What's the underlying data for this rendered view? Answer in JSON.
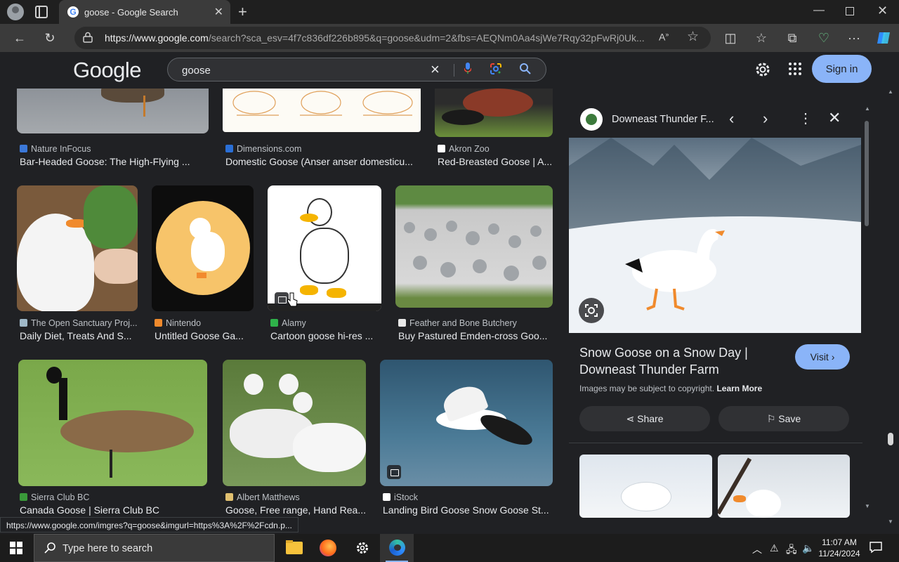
{
  "browser": {
    "tab_title": "goose - Google Search",
    "url_host": "https://www.google.com",
    "url_rest": "/search?sca_esv=4f7c836df226b895&q=goose&udm=2&fbs=AEQNm0Aa4sjWe7Rqy32pFwRj0Uk..."
  },
  "google": {
    "logo": "Google",
    "query": "goose",
    "signin_label": "Sign in"
  },
  "results": [
    {
      "source": "Nature InFocus",
      "caption": "Bar-Headed Goose: The High-Flying ..."
    },
    {
      "source": "Dimensions.com",
      "caption": "Domestic Goose (Anser anser domesticu..."
    },
    {
      "source": "Akron Zoo",
      "caption": "Red-Breasted Goose | A..."
    },
    {
      "source": "The Open Sanctuary Proj...",
      "caption": "Daily Diet, Treats And S..."
    },
    {
      "source": "Nintendo",
      "caption": "Untitled Goose Ga..."
    },
    {
      "source": "Alamy",
      "caption": "Cartoon goose hi-res ..."
    },
    {
      "source": "Feather and Bone Butchery",
      "caption": "Buy Pastured Emden-cross Goo..."
    },
    {
      "source": "Sierra Club BC",
      "caption": "Canada Goose | Sierra Club BC"
    },
    {
      "source": "Albert Matthews",
      "caption": "Goose, Free range, Hand Rea..."
    },
    {
      "source": "iStock",
      "caption": "Landing Bird Goose Snow Goose St..."
    }
  ],
  "panel": {
    "site": "Downeast Thunder F...",
    "title": "Snow Goose on a Snow Day | Downeast Thunder Farm",
    "visit_label": "Visit ›",
    "copyright": "Images may be subject to copyright.",
    "learn_more": "Learn More",
    "share_label": "Share",
    "save_label": "Save"
  },
  "status_url": "https://www.google.com/imgres?q=goose&imgurl=https%3A%2F%2Fcdn.p...",
  "taskbar": {
    "search_placeholder": "Type here to search",
    "time": "11:07 AM",
    "date": "11/24/2024"
  },
  "colors": {
    "accent": "#8ab4f8",
    "background": "#202124",
    "chrome": "#3b3b3b"
  }
}
